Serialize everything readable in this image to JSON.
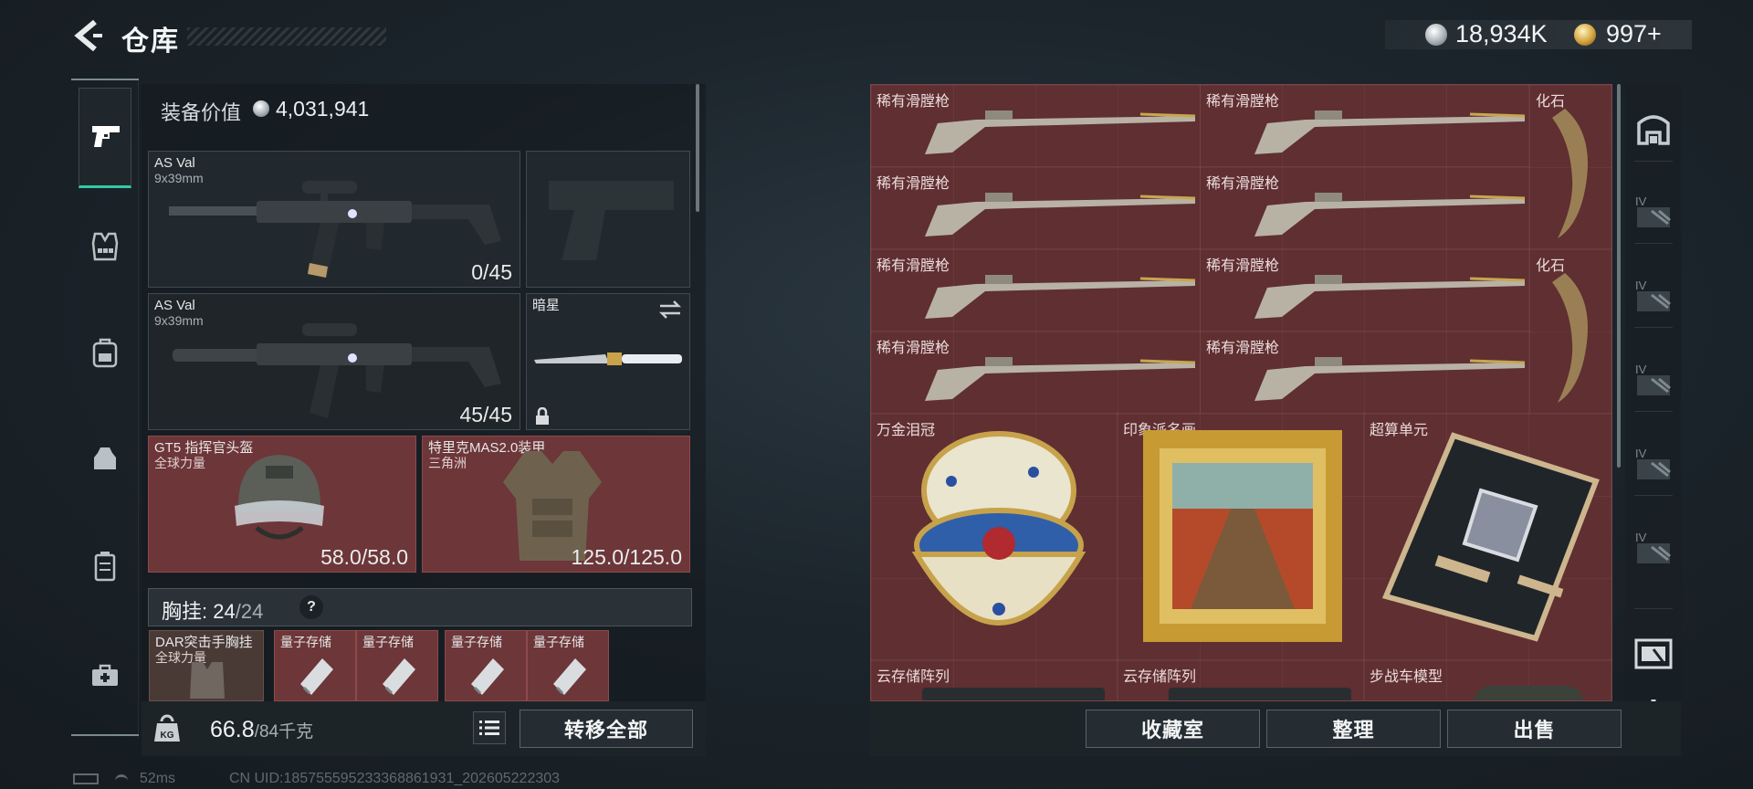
{
  "header": {
    "title": "仓库",
    "currency_silver": "18,934K",
    "currency_gold": "997+"
  },
  "left_tabs": [
    {
      "icon": "pistol-icon",
      "active": true
    },
    {
      "icon": "vest-icon",
      "active": false
    },
    {
      "icon": "backpack-icon",
      "active": false
    },
    {
      "icon": "pouch-icon",
      "active": false
    },
    {
      "icon": "case-icon",
      "active": false
    },
    {
      "icon": "medkit-icon",
      "active": false
    }
  ],
  "equipment": {
    "value_label": "装备价值",
    "value": "4,031,941",
    "primary1": {
      "name": "AS Val",
      "caliber": "9x39mm",
      "ammo": "0/45"
    },
    "primary2": {
      "name": "AS Val",
      "caliber": "9x39mm",
      "ammo": "45/45"
    },
    "melee": {
      "name": "暗星"
    },
    "helmet": {
      "name": "GT5 指挥官头盔",
      "sub": "全球力量",
      "durability": "58.0/58.0"
    },
    "armor": {
      "name": "特里克MAS2.0装甲",
      "sub": "三角洲",
      "durability": "125.0/125.0"
    },
    "chest_rig": {
      "label": "胸挂:",
      "cap_used": "24",
      "cap_total": "/24",
      "help": "?"
    },
    "rig_item": {
      "name": "DAR突击手胸挂",
      "sub": "全球力量"
    },
    "quantum_slots": [
      "量子存储",
      "量子存储",
      "量子存储",
      "量子存储"
    ],
    "weight": "66.8",
    "weight_max": "/84千克",
    "transfer_all": "转移全部"
  },
  "stash": {
    "rows": [
      [
        "稀有滑膛枪",
        "稀有滑膛枪",
        "化石"
      ],
      [
        "稀有滑膛枪",
        "稀有滑膛枪"
      ],
      [
        "稀有滑膛枪",
        "稀有滑膛枪",
        "化石"
      ],
      [
        "稀有滑膛枪",
        "稀有滑膛枪"
      ]
    ],
    "large_items": [
      "万金泪冠",
      "印象派名画",
      "超算单元"
    ],
    "bottom_items": [
      "云存储阵列",
      "云存储阵列",
      "步战车模型"
    ],
    "buttons": {
      "collection": "收藏室",
      "organize": "整理",
      "sell": "出售"
    }
  },
  "side_tools": [
    {
      "icon": "stash-icon",
      "label": ""
    },
    {
      "icon": "case-4-icon",
      "label": "IV"
    },
    {
      "icon": "case-4-icon",
      "label": "IV"
    },
    {
      "icon": "case-4-icon",
      "label": "IV"
    },
    {
      "icon": "case-4-icon",
      "label": "IV"
    },
    {
      "icon": "case-4-icon",
      "label": "IV"
    },
    {
      "icon": "case-tool-icon",
      "label": ""
    },
    {
      "icon": "gear-icon",
      "label": ""
    }
  ],
  "status": {
    "ping": "52ms",
    "uid": "CN UID:185755595233368861931_202605222303"
  },
  "colors": {
    "accent": "#2fcba6",
    "slot_red": "#6d3639",
    "stash_bg": "#5f2f32"
  }
}
